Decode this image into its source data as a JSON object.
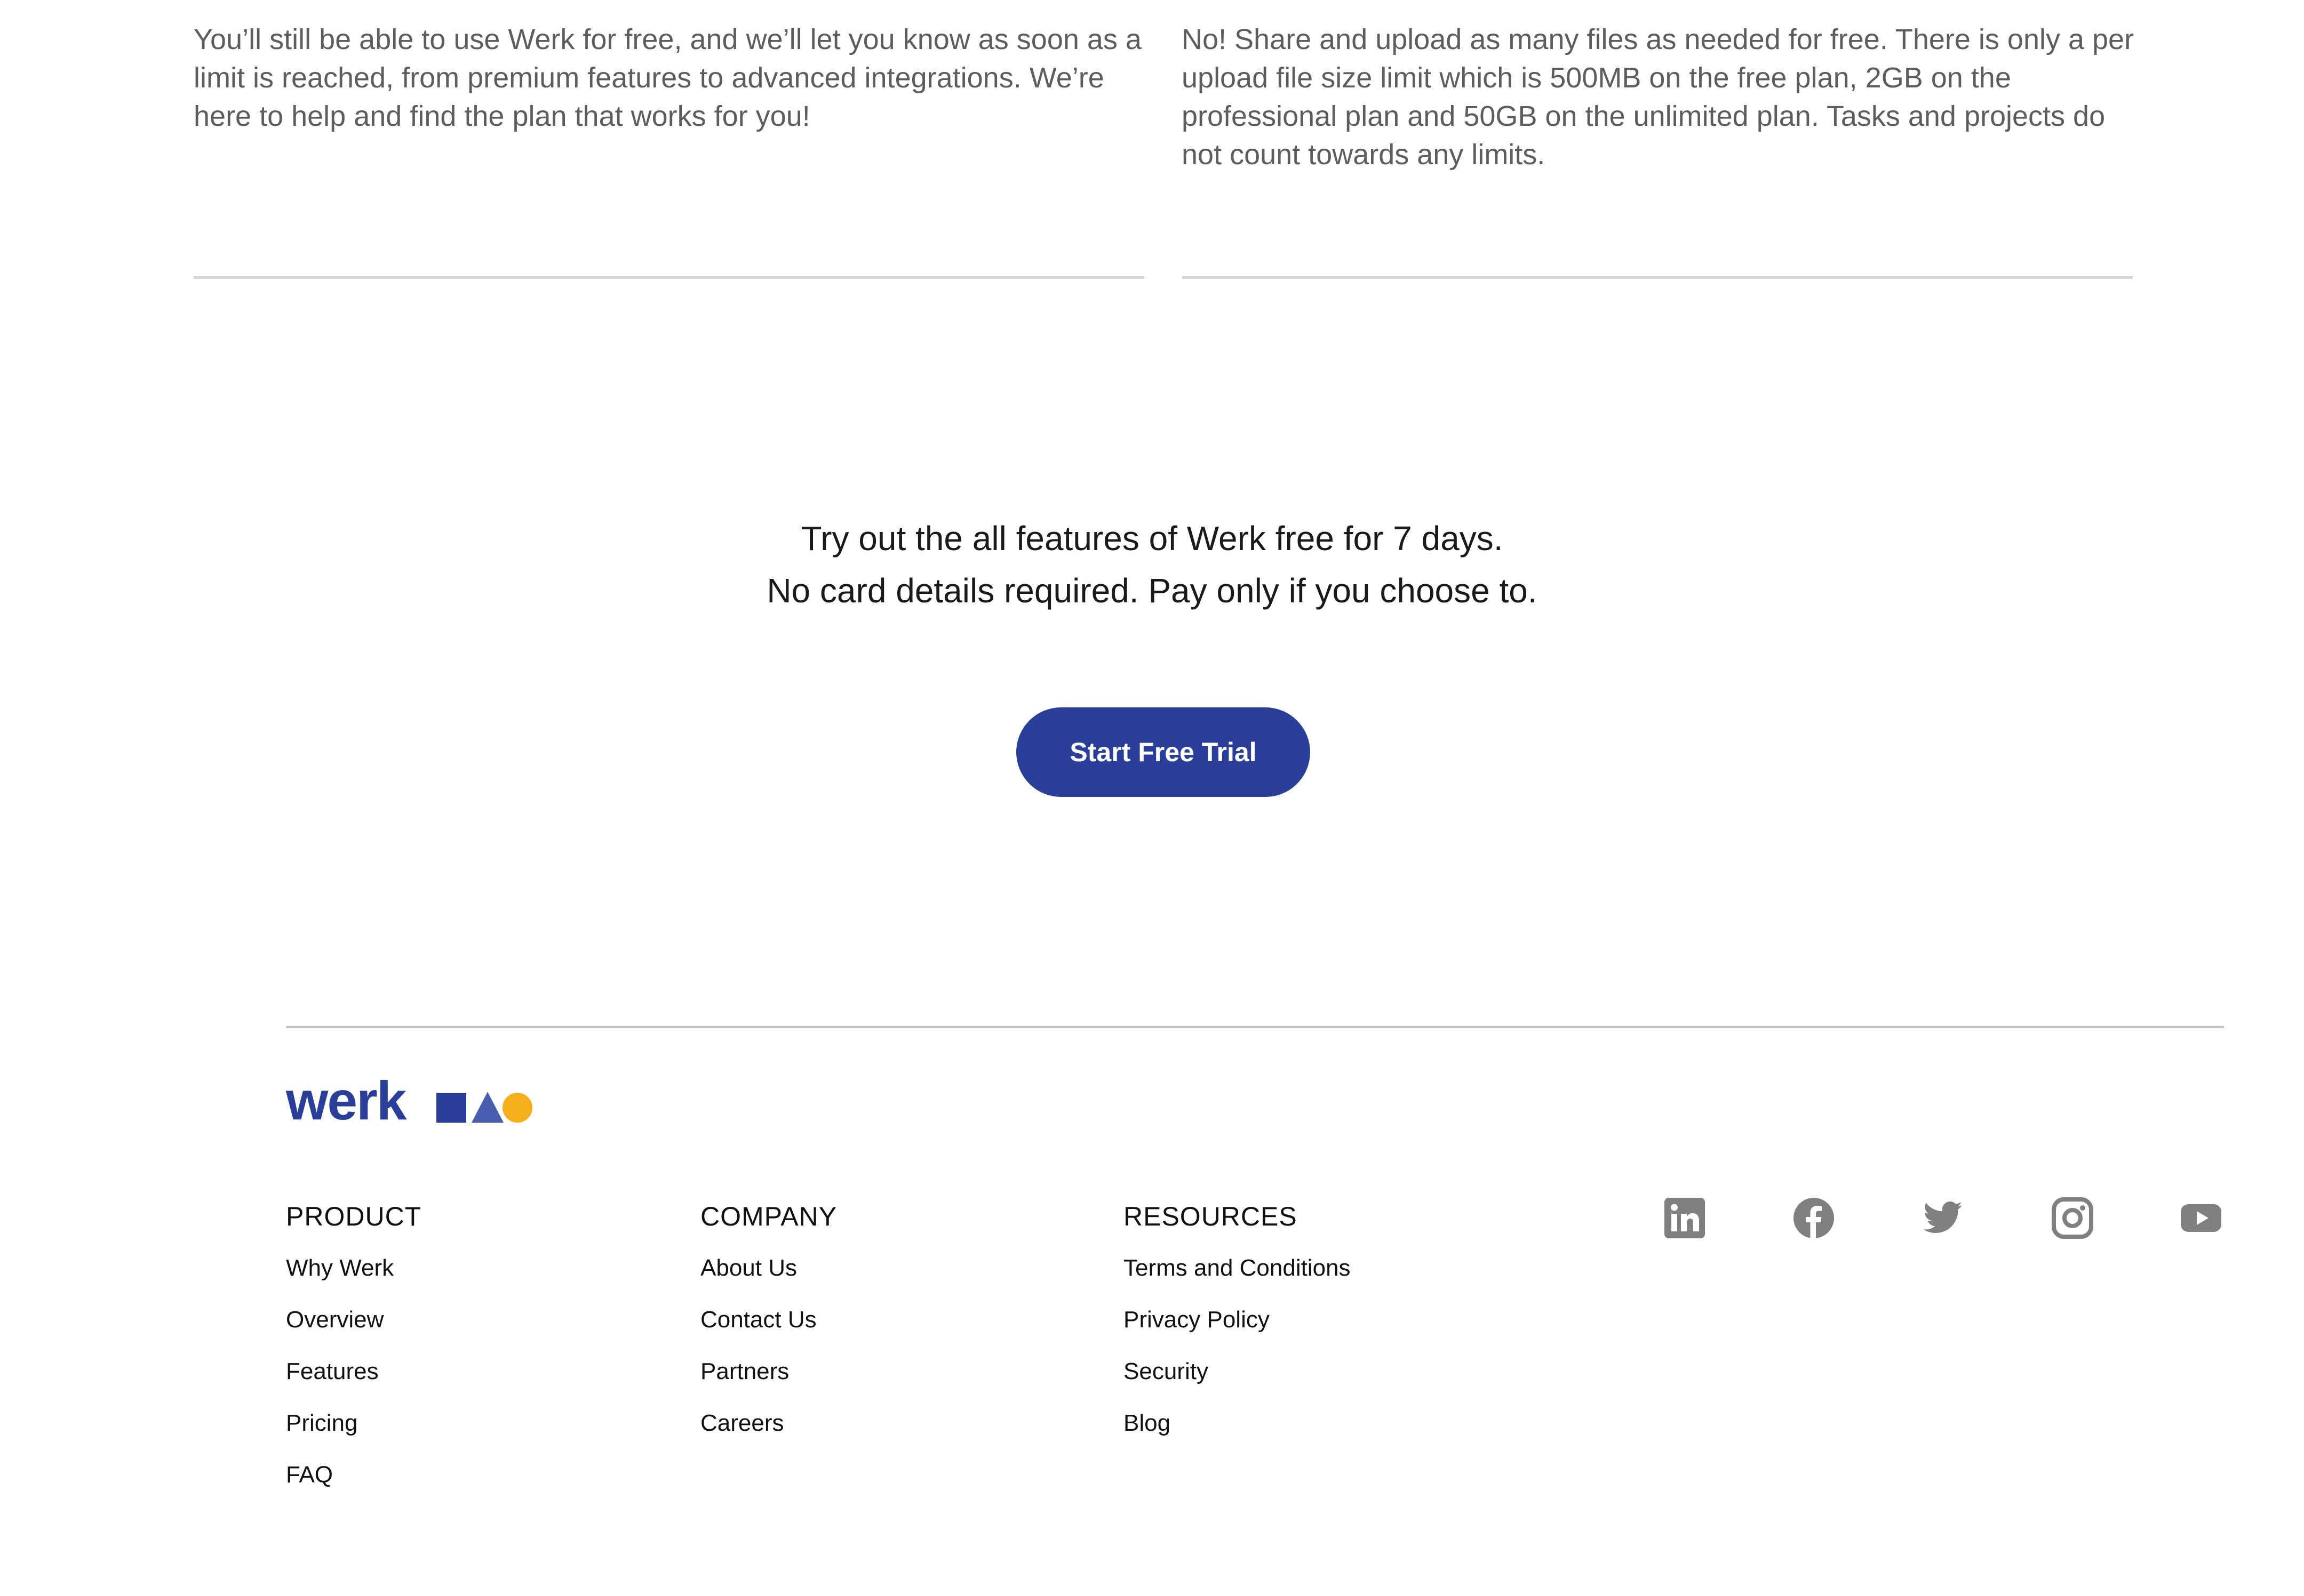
{
  "faq": {
    "answer_left": "You’ll still be able to use Werk for free, and we’ll let you know as soon as a limit is reached, from premium features to advanced integrations. We’re here to help and find the plan that works for you!",
    "answer_right": "No! Share and upload as many files as needed for free. There is only a per upload file size limit which is 500MB on the free plan, 2GB on the professional plan and 50GB on the unlimited plan. Tasks and projects do not count towards any limits."
  },
  "cta": {
    "line1": "Try out the all features of Werk free for 7 days.",
    "line2": "No card details required.  Pay only if you choose to.",
    "button_label": "Start Free Trial"
  },
  "footer": {
    "logo_text": "werk",
    "columns": [
      {
        "heading": "PRODUCT",
        "links": [
          "Why Werk",
          "Overview",
          "Features",
          "Pricing",
          "FAQ"
        ]
      },
      {
        "heading": "COMPANY",
        "links": [
          "About Us",
          "Contact Us",
          "Partners",
          "Careers"
        ]
      },
      {
        "heading": "RESOURCES",
        "links": [
          "Terms and Conditions",
          "Privacy Policy",
          "Security",
          "Blog"
        ]
      }
    ],
    "social_icons": [
      "linkedin-icon",
      "facebook-icon",
      "twitter-icon",
      "instagram-icon",
      "youtube-icon"
    ]
  },
  "colors": {
    "brand_blue": "#2a3f99",
    "brand_yellow": "#f4b01c",
    "social_grey": "#808080",
    "body_text_grey": "#5d5d5d"
  }
}
